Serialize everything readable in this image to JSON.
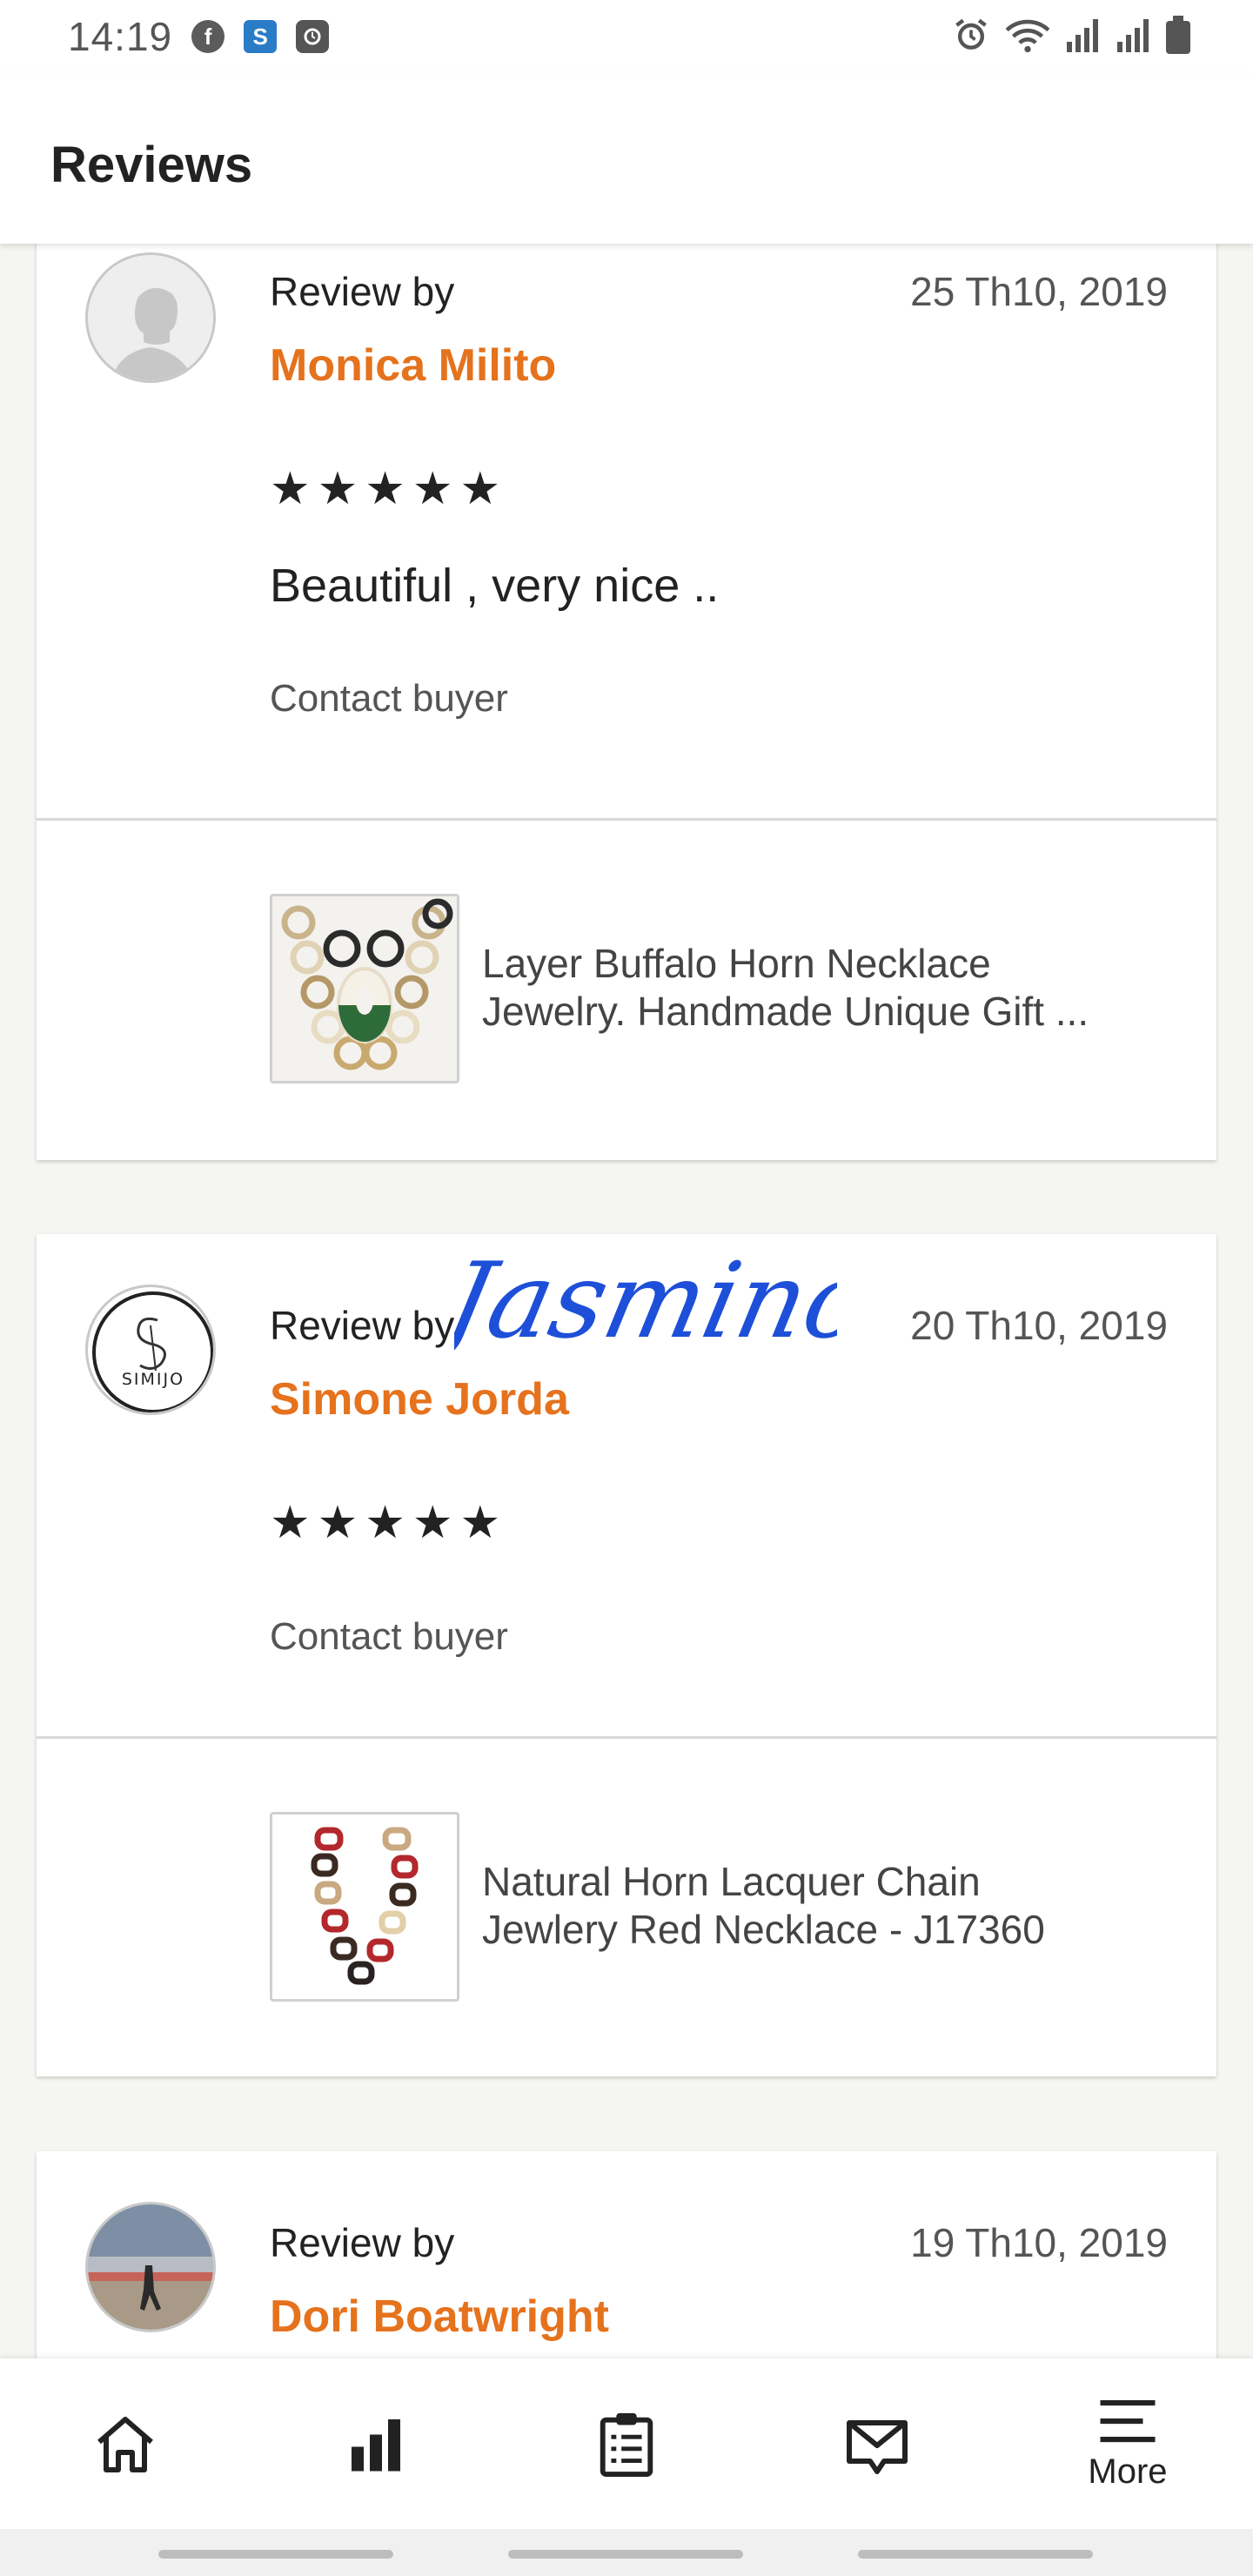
{
  "status_bar": {
    "time": "14:19"
  },
  "header": {
    "title": "Reviews"
  },
  "reviews": [
    {
      "review_by_label": "Review by",
      "reviewer": "Monica Milito",
      "date": "25 Th10, 2019",
      "stars": "★★★★★",
      "text": "Beautiful , very nice ..",
      "contact_label": "Contact buyer",
      "listing_title_line1": "Layer Buffalo Horn Necklace",
      "listing_title_line2": "Jewelry. Handmade Unique Gift ..."
    },
    {
      "review_by_label": "Review by",
      "reviewer": "Simone Jorda",
      "date": "20 Th10, 2019",
      "stars": "★★★★★",
      "signature": "Jasmino",
      "avatar_text": "SIMIJO",
      "contact_label": "Contact buyer",
      "listing_title_line1": "Natural Horn Lacquer Chain",
      "listing_title_line2": "Jewlery Red Necklace  - J17360"
    },
    {
      "review_by_label": "Review by",
      "reviewer": "Dori Boatwright",
      "date": "19 Th10, 2019"
    }
  ],
  "bottom_nav": {
    "items": [
      {
        "icon": "home-icon"
      },
      {
        "icon": "stats-icon"
      },
      {
        "icon": "orders-clipboard-icon"
      },
      {
        "icon": "messages-icon"
      },
      {
        "icon": "menu-icon",
        "label": "More"
      }
    ]
  },
  "colors": {
    "accent": "#e5721d",
    "text": "#222222",
    "muted": "#555555",
    "background": "#f5f5f1"
  }
}
